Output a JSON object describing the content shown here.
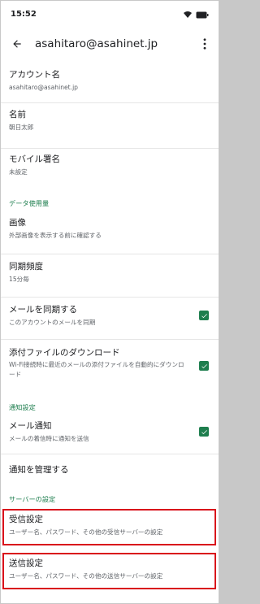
{
  "status_bar": {
    "time": "15:52"
  },
  "app_bar": {
    "title": "asahitaro@asahinet.jp"
  },
  "items": {
    "account_name": {
      "title": "アカウント名",
      "sub": "asahitaro@asahinet.jp"
    },
    "name": {
      "title": "名前",
      "sub": "朝日太郎"
    },
    "mobile_signature": {
      "title": "モバイル署名",
      "sub": "未設定"
    },
    "images": {
      "title": "画像",
      "sub": "外部画像を表示する前に確認する"
    },
    "sync_frequency": {
      "title": "同期頻度",
      "sub": "15分毎"
    },
    "sync_mail": {
      "title": "メールを同期する",
      "sub": "このアカウントのメールを同期",
      "checked": true
    },
    "download_attachments": {
      "title": "添付ファイルのダウンロード",
      "sub": "Wi-Fi接続時に最近のメールの添付ファイルを自動的にダウンロード",
      "checked": true
    },
    "email_notifications": {
      "title": "メール通知",
      "sub": "メールの着信時に通知を送信",
      "checked": true
    },
    "manage_notifications": {
      "title": "通知を管理する"
    },
    "incoming_settings": {
      "title": "受信設定",
      "sub": "ユーザー名、パスワード、その他の受信サーバーの設定"
    },
    "outgoing_settings": {
      "title": "送信設定",
      "sub": "ユーザー名、パスワード、その他の送信サーバーの設定"
    }
  },
  "sections": {
    "data_usage": "データ使用量",
    "notification_settings": "通知設定",
    "server_settings": "サーバーの設定"
  },
  "colors": {
    "accent": "#1e7e4e",
    "highlight_border": "#d9101b"
  },
  "icons": {
    "back": "arrow-back-icon",
    "more": "more-vert-icon",
    "check": "check-icon",
    "wifi": "wifi-icon",
    "battery": "battery-icon"
  }
}
